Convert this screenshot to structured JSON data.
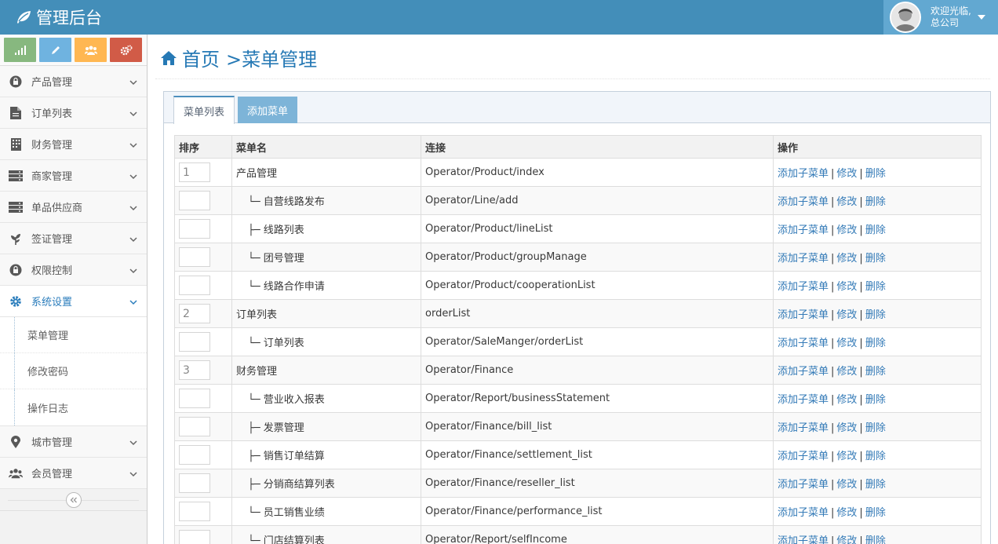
{
  "navbar": {
    "brand": "管理后台",
    "user_line1": "欢迎光临,",
    "user_line2": "总公司"
  },
  "colors": {
    "navbar": "#438eb9",
    "shortcut_green": "#87b87f",
    "shortcut_blue": "#6fb3e0",
    "shortcut_yellow": "#ffb752",
    "shortcut_red": "#d15b47",
    "link": "#337ab7"
  },
  "sidebar": {
    "shortcuts": [
      {
        "icon": "signal-icon",
        "color": "#87b87f"
      },
      {
        "icon": "pencil-icon",
        "color": "#6fb3e0"
      },
      {
        "icon": "users-icon",
        "color": "#ffb752"
      },
      {
        "icon": "cogs-icon",
        "color": "#d15b47"
      }
    ],
    "items": [
      {
        "label": "产品管理",
        "icon": "lock-icon"
      },
      {
        "label": "订单列表",
        "icon": "file-icon"
      },
      {
        "label": "财务管理",
        "icon": "building-icon"
      },
      {
        "label": "商家管理",
        "icon": "server-icon"
      },
      {
        "label": "单品供应商",
        "icon": "server-icon"
      },
      {
        "label": "签证管理",
        "icon": "leaf-icon"
      },
      {
        "label": "权限控制",
        "icon": "lock-icon"
      },
      {
        "label": "系统设置",
        "icon": "gear-icon"
      }
    ],
    "submenu": [
      "菜单管理",
      "修改密码",
      "操作日志"
    ],
    "items_after": [
      {
        "label": "城市管理",
        "icon": "map-marker-icon"
      },
      {
        "label": "会员管理",
        "icon": "users-icon"
      }
    ]
  },
  "main": {
    "breadcrumb_home": "首页",
    "breadcrumb_current": ">菜单管理",
    "tabs": [
      "菜单列表",
      "添加菜单"
    ],
    "table": {
      "headers": [
        "排序",
        "菜单名",
        "连接",
        "操作"
      ],
      "actions": [
        "添加子菜单",
        "修改",
        "删除"
      ],
      "rows": [
        {
          "sort": "1",
          "name": "产品管理",
          "link": "Operator/Product/index",
          "child": false
        },
        {
          "sort": "",
          "name": "└─ 自营线路发布",
          "link": "Operator/Line/add",
          "child": true
        },
        {
          "sort": "",
          "name": "├─ 线路列表",
          "link": "Operator/Product/lineList",
          "child": true
        },
        {
          "sort": "",
          "name": "└─ 团号管理",
          "link": "Operator/Product/groupManage",
          "child": true
        },
        {
          "sort": "",
          "name": "└─ 线路合作申请",
          "link": "Operator/Product/cooperationList",
          "child": true
        },
        {
          "sort": "2",
          "name": "订单列表",
          "link": "orderList",
          "child": false
        },
        {
          "sort": "",
          "name": "└─ 订单列表",
          "link": "Operator/SaleManger/orderList",
          "child": true
        },
        {
          "sort": "3",
          "name": "财务管理",
          "link": "Operator/Finance",
          "child": false
        },
        {
          "sort": "",
          "name": "└─ 营业收入报表",
          "link": "Operator/Report/businessStatement",
          "child": true
        },
        {
          "sort": "",
          "name": "├─ 发票管理",
          "link": "Operator/Finance/bill_list",
          "child": true
        },
        {
          "sort": "",
          "name": "├─ 销售订单结算",
          "link": "Operator/Finance/settlement_list",
          "child": true
        },
        {
          "sort": "",
          "name": "├─ 分销商结算列表",
          "link": "Operator/Finance/reseller_list",
          "child": true
        },
        {
          "sort": "",
          "name": "└─ 员工销售业绩",
          "link": "Operator/Finance/performance_list",
          "child": true
        },
        {
          "sort": "",
          "name": "└─ 门店结算列表",
          "link": "Operator/Report/selfIncome",
          "child": true
        }
      ]
    }
  }
}
